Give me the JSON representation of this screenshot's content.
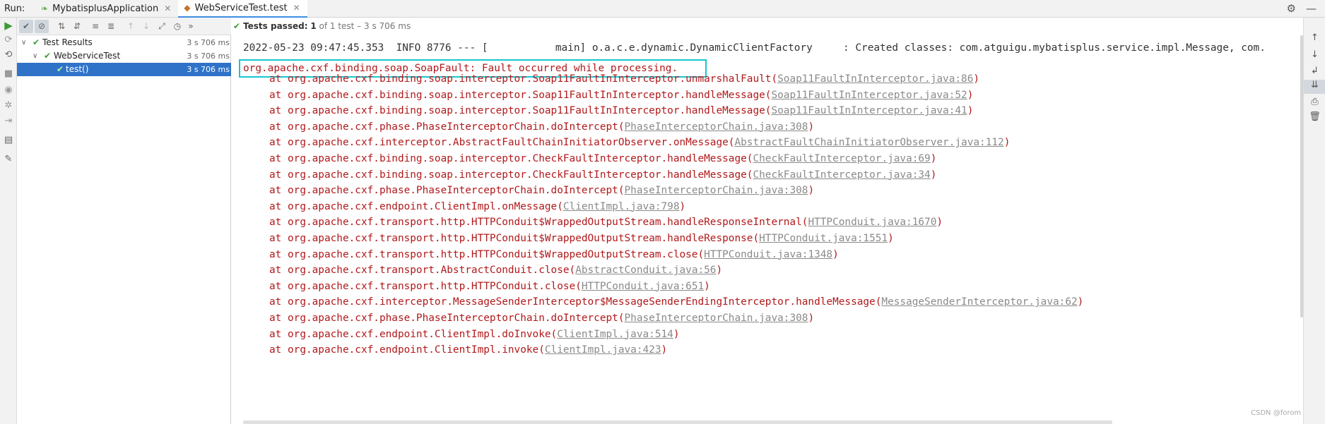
{
  "tabbar": {
    "run_label": "Run:",
    "tabs": [
      {
        "label": "MybatisplusApplication",
        "close": "✕"
      },
      {
        "label": "WebServiceTest.test",
        "close": "✕"
      }
    ],
    "settings_icon": "gear-icon",
    "minimize_icon": "minus-icon"
  },
  "status": {
    "check": "✔",
    "prefix": "Tests passed:",
    "count": "1",
    "rest": "of 1 test – 3 s 706 ms"
  },
  "tree": {
    "rows": [
      {
        "name": "Test Results",
        "duration": "3 s 706 ms"
      },
      {
        "name": "WebServiceTest",
        "duration": "3 s 706 ms"
      },
      {
        "name": "test()",
        "duration": "3 s 706 ms"
      }
    ]
  },
  "console": {
    "info_line": "2022-05-23 09:47:45.353  INFO 8776 --- [           main] o.a.c.e.dynamic.DynamicClientFactory     : Created classes: com.atguigu.mybatisplus.service.impl.Message, com.",
    "exception": "org.apache.cxf.binding.soap.SoapFault: Fault occurred while processing.",
    "frames": [
      {
        "text": "at org.apache.cxf.binding.soap.interceptor.Soap11FaultInInterceptor.unmarshalFault",
        "link": "Soap11FaultInInterceptor.java:86"
      },
      {
        "text": "at org.apache.cxf.binding.soap.interceptor.Soap11FaultInInterceptor.handleMessage",
        "link": "Soap11FaultInInterceptor.java:52"
      },
      {
        "text": "at org.apache.cxf.binding.soap.interceptor.Soap11FaultInInterceptor.handleMessage",
        "link": "Soap11FaultInInterceptor.java:41"
      },
      {
        "text": "at org.apache.cxf.phase.PhaseInterceptorChain.doIntercept",
        "link": "PhaseInterceptorChain.java:308"
      },
      {
        "text": "at org.apache.cxf.interceptor.AbstractFaultChainInitiatorObserver.onMessage",
        "link": "AbstractFaultChainInitiatorObserver.java:112"
      },
      {
        "text": "at org.apache.cxf.binding.soap.interceptor.CheckFaultInterceptor.handleMessage",
        "link": "CheckFaultInterceptor.java:69"
      },
      {
        "text": "at org.apache.cxf.binding.soap.interceptor.CheckFaultInterceptor.handleMessage",
        "link": "CheckFaultInterceptor.java:34"
      },
      {
        "text": "at org.apache.cxf.phase.PhaseInterceptorChain.doIntercept",
        "link": "PhaseInterceptorChain.java:308"
      },
      {
        "text": "at org.apache.cxf.endpoint.ClientImpl.onMessage",
        "link": "ClientImpl.java:798"
      },
      {
        "text": "at org.apache.cxf.transport.http.HTTPConduit$WrappedOutputStream.handleResponseInternal",
        "link": "HTTPConduit.java:1670"
      },
      {
        "text": "at org.apache.cxf.transport.http.HTTPConduit$WrappedOutputStream.handleResponse",
        "link": "HTTPConduit.java:1551"
      },
      {
        "text": "at org.apache.cxf.transport.http.HTTPConduit$WrappedOutputStream.close",
        "link": "HTTPConduit.java:1348"
      },
      {
        "text": "at org.apache.cxf.transport.AbstractConduit.close",
        "link": "AbstractConduit.java:56"
      },
      {
        "text": "at org.apache.cxf.transport.http.HTTPConduit.close",
        "link": "HTTPConduit.java:651"
      },
      {
        "text": "at org.apache.cxf.interceptor.MessageSenderInterceptor$MessageSenderEndingInterceptor.handleMessage",
        "link": "MessageSenderInterceptor.java:62"
      },
      {
        "text": "at org.apache.cxf.phase.PhaseInterceptorChain.doIntercept",
        "link": "PhaseInterceptorChain.java:308"
      },
      {
        "text": "at org.apache.cxf.endpoint.ClientImpl.doInvoke",
        "link": "ClientImpl.java:514"
      },
      {
        "text": "at org.apache.cxf.endpoint.ClientImpl.invoke",
        "link": "ClientImpl.java:423"
      }
    ]
  },
  "watermark": "CSDN @forom",
  "colors": {
    "error": "#b1191b",
    "link": "#8a8a8a",
    "selection": "#2f73c9",
    "pass": "#3d9b35",
    "highlight": "#19c6cf"
  }
}
